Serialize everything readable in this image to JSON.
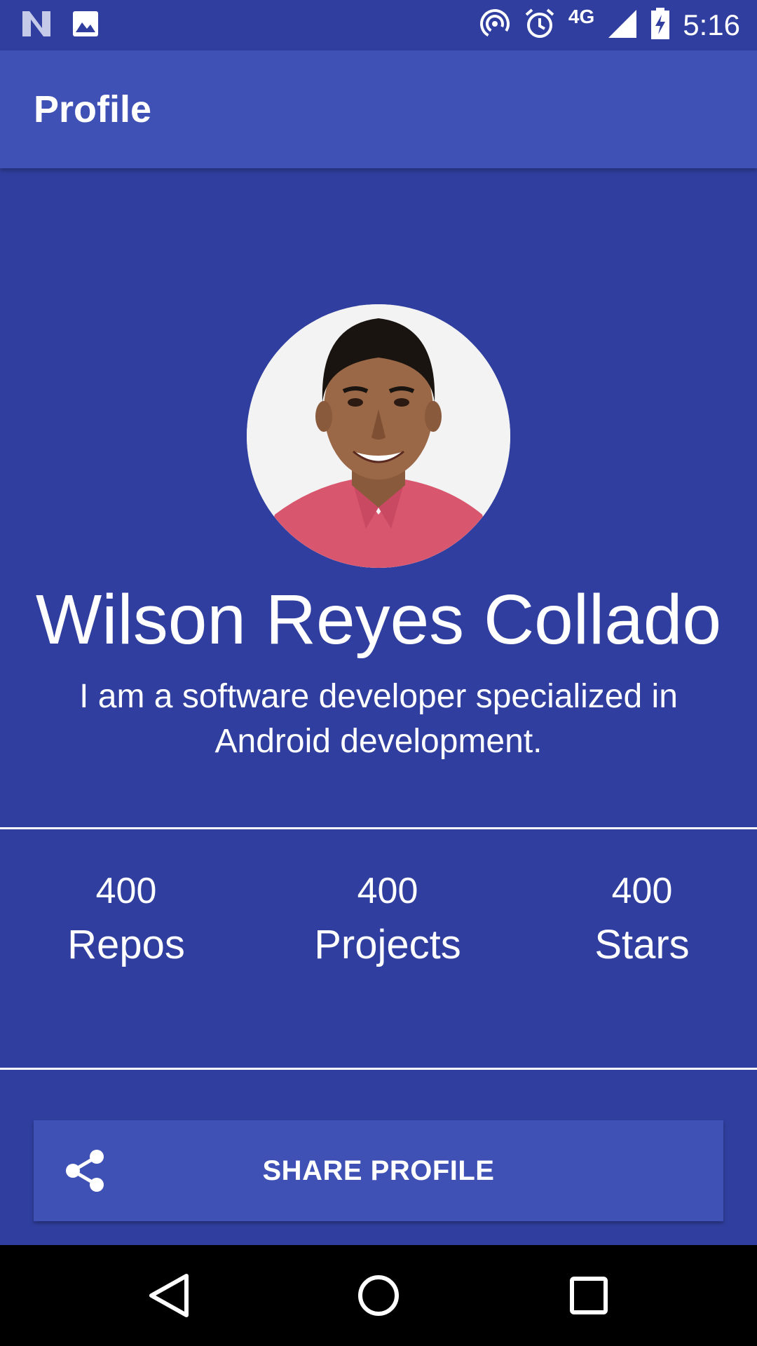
{
  "status_bar": {
    "left_icons": [
      "n-notification-icon",
      "image-notification-icon"
    ],
    "right_icons": [
      "hotspot-icon",
      "alarm-icon",
      "signal-icon",
      "battery-charging-icon"
    ],
    "network_type": "4G",
    "time": "5:16"
  },
  "app_bar": {
    "title": "Profile"
  },
  "profile": {
    "name": "Wilson Reyes Collado",
    "bio": "I am a software developer specialized in Android development."
  },
  "stats": [
    {
      "value": "400",
      "label": "Repos"
    },
    {
      "value": "400",
      "label": "Projects"
    },
    {
      "value": "400",
      "label": "Stars"
    }
  ],
  "share_button": {
    "label": "SHARE PROFILE",
    "icon": "share-icon"
  },
  "nav_bar": {
    "buttons": [
      "back-icon",
      "home-icon",
      "recents-icon"
    ]
  },
  "colors": {
    "background": "#303F9F",
    "app_bar": "#3F51B5",
    "button": "#3F51B5",
    "text": "#FFFFFF",
    "nav_bar": "#000000"
  }
}
